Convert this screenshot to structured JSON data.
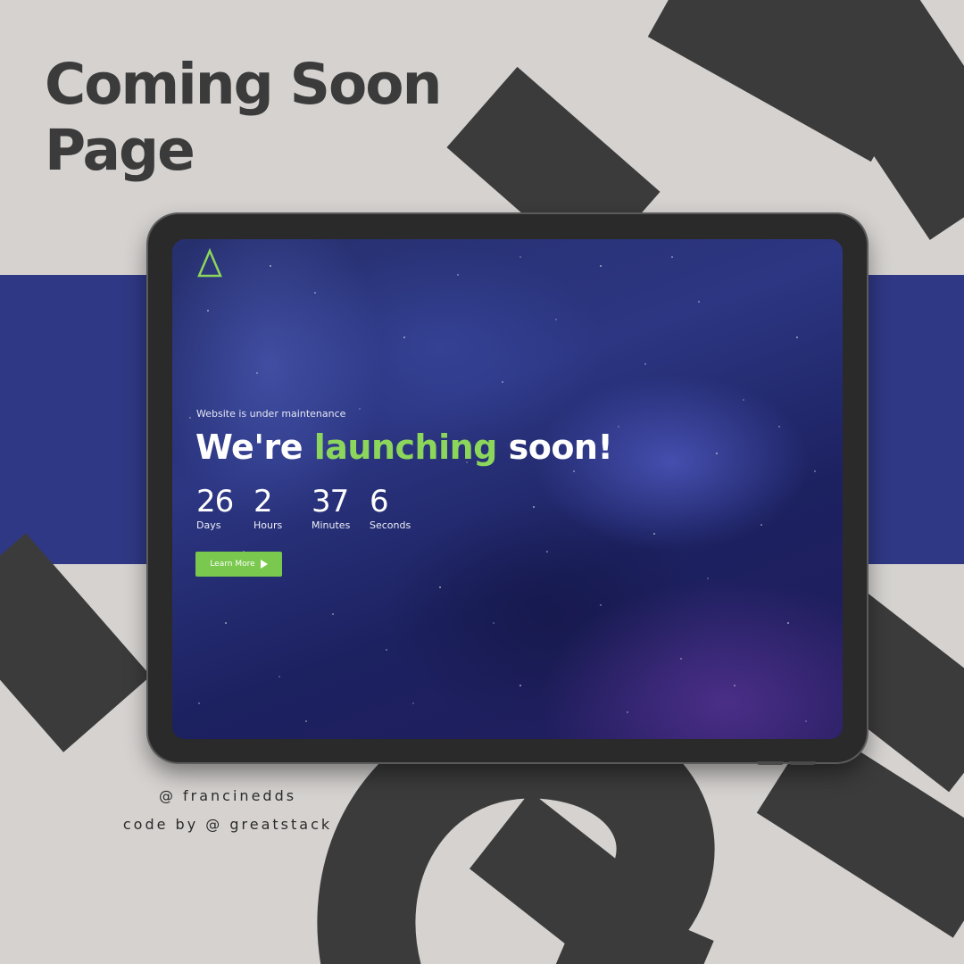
{
  "poster": {
    "title_line1": "Coming Soon",
    "title_line2": "Page",
    "credit_design": "@ francinedds",
    "credit_code": "code by @ greatstack",
    "colors": {
      "background": "#d5d2d0",
      "band": "#2f3884",
      "deco_letters": "#3b3b3b"
    }
  },
  "site": {
    "logo_icon": "triangle-logo-icon",
    "subtitle": "Website is under maintenance",
    "headline_pre": "We're",
    "headline_accent": "launching",
    "headline_post": "soon!",
    "accent_color": "#8bd65b",
    "countdown": [
      {
        "value": "26",
        "label": "Days"
      },
      {
        "value": "2",
        "label": "Hours"
      },
      {
        "value": "37",
        "label": "Minutes"
      },
      {
        "value": "6",
        "label": "Seconds"
      }
    ],
    "cta_label": "Learn More",
    "cta_icon": "play-icon",
    "cta_color": "#7ac94e"
  }
}
